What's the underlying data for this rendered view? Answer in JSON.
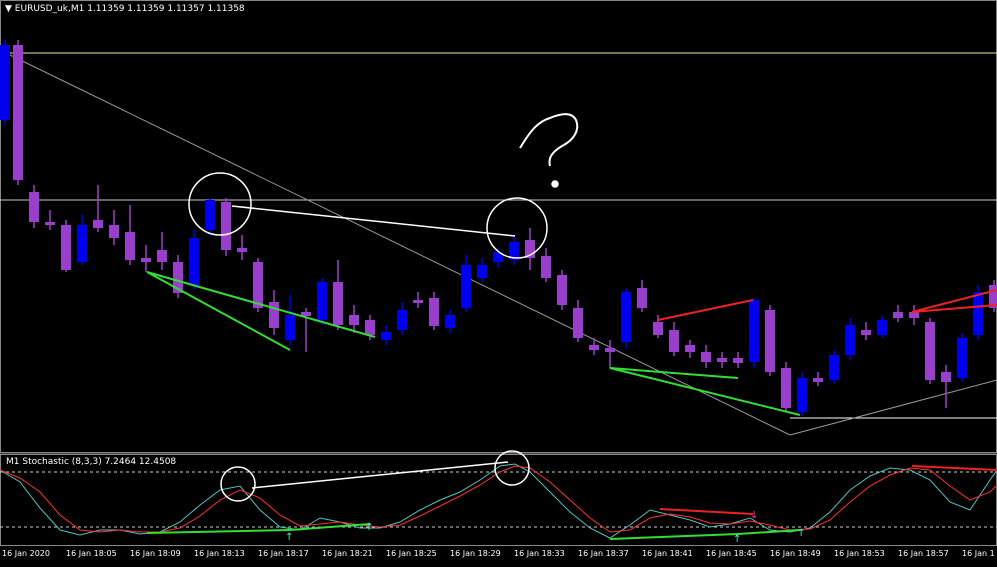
{
  "main_window": {
    "symbol_label": "EURUSD_uk,M1",
    "ohlc": "1.11359 1.11359 1.11357 1.11358"
  },
  "sub_window": {
    "indicator_label": "M1 Stochastic (8,3,3) 7.2464 12.4508"
  },
  "time_axis": {
    "labels": [
      "16 Jan 2020",
      "16 Jan 18:05",
      "16 Jan 18:09",
      "16 Jan 18:13",
      "16 Jan 18:17",
      "16 Jan 18:21",
      "16 Jan 18:25",
      "16 Jan 18:29",
      "16 Jan 18:33",
      "16 Jan 18:37",
      "16 Jan 18:41",
      "16 Jan 18:45",
      "16 Jan 18:49",
      "16 Jan 18:53",
      "16 Jan 18:57",
      "16 Jan 1"
    ]
  },
  "colors": {
    "bull": "#0000ee",
    "bear": "#9a3fcc",
    "hline": "#e8e8a0",
    "support": "#33dd33",
    "resistance": "#ee2222",
    "annotation": "#ffffff",
    "stoch_main": "#4fc3c3",
    "stoch_signal": "#ff3030"
  }
}
